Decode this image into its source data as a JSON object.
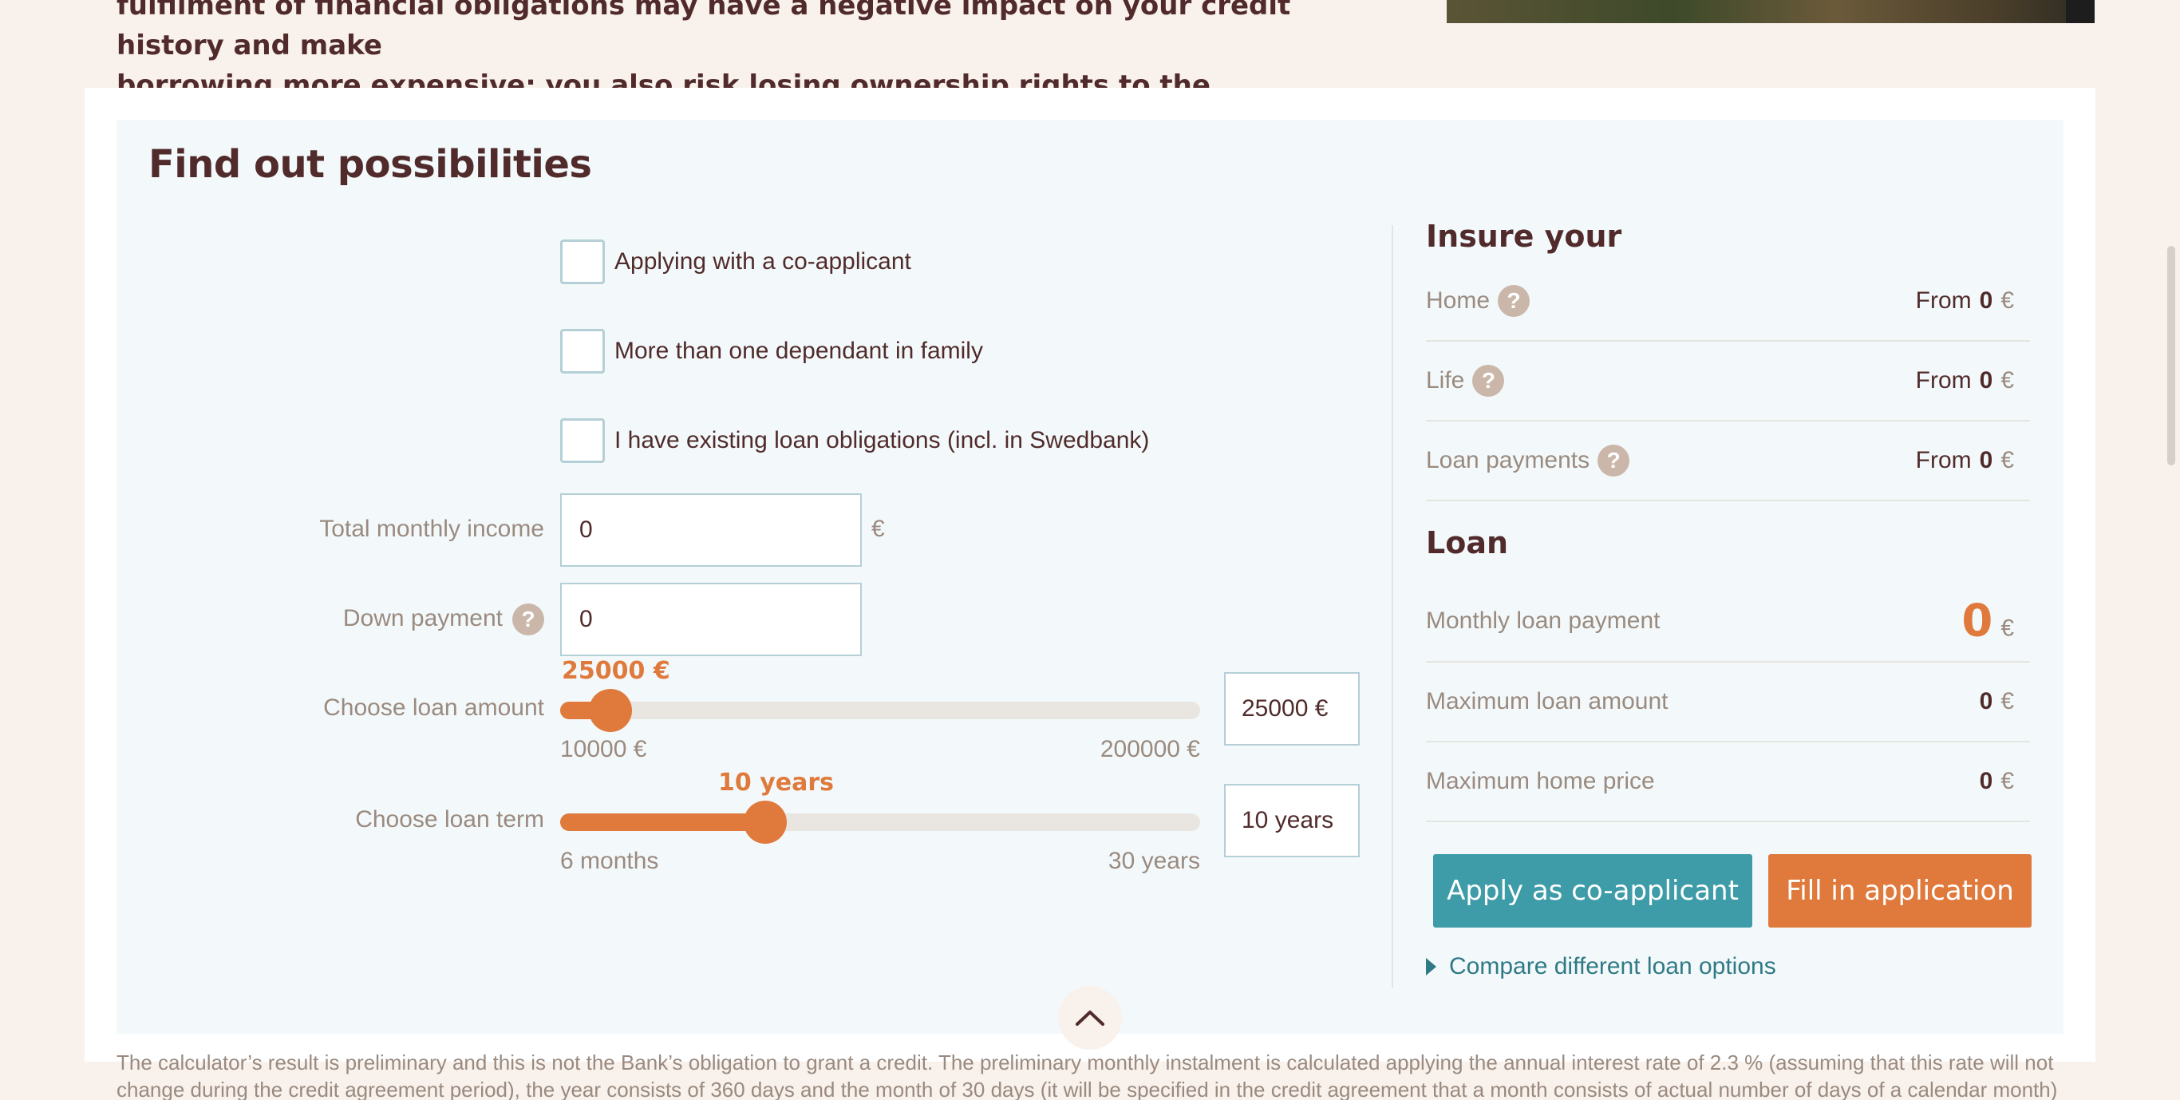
{
  "intro": {
    "line1": "fulfilment of financial obligations may have a negative impact on your credit history and make",
    "line2": "borrowing more expensive; you also risk losing ownership rights to the mortgaged real estate."
  },
  "calculator": {
    "title": "Find out possibilities",
    "checkboxes": {
      "co_applicant": "Applying with a co-applicant",
      "dependants": "More than one dependant in family",
      "existing_loans": "I have existing loan obligations (incl. in Swedbank)"
    },
    "income": {
      "label": "Total monthly income",
      "value": "0",
      "unit": "€"
    },
    "down_payment": {
      "label": "Down payment",
      "value": "0",
      "help": "?"
    },
    "loan_amount": {
      "label": "Choose loan amount",
      "value_label": "25000 €",
      "min_label": "10000 €",
      "max_label": "200000 €",
      "box_value": "25000 €",
      "min": 10000,
      "max": 200000,
      "value": 25000
    },
    "loan_term": {
      "label": "Choose loan term",
      "value_label": "10 years",
      "min_label": "6 months",
      "max_label": "30 years",
      "box_value": "10 years",
      "fraction": 0.32
    }
  },
  "insure": {
    "heading": "Insure your",
    "rows": [
      {
        "label": "Home",
        "help": "?",
        "prefix": "From",
        "value": "0",
        "currency": "€"
      },
      {
        "label": "Life",
        "help": "?",
        "prefix": "From",
        "value": "0",
        "currency": "€"
      },
      {
        "label": "Loan payments",
        "help": "?",
        "prefix": "From",
        "value": "0",
        "currency": "€"
      }
    ]
  },
  "loan": {
    "heading": "Loan",
    "monthly": {
      "label": "Monthly loan payment",
      "value": "0",
      "currency": "€"
    },
    "max_amount": {
      "label": "Maximum loan amount",
      "value": "0",
      "currency": "€"
    },
    "max_price": {
      "label": "Maximum home price",
      "value": "0",
      "currency": "€"
    }
  },
  "buttons": {
    "co_applicant": "Apply as co-applicant",
    "fill": "Fill in application",
    "compare": "Compare different loan options"
  },
  "disclaimer": "The calculator’s result is preliminary and this is not the Bank’s obligation to grant a credit. The preliminary monthly instalment is calculated applying the annual interest rate of 2.3 % (assuming that this rate will not change during the credit agreement period), the year consists of 360 days and the month of 30 days (it will be specified in the credit agreement that a month consists of actual number of days of a calendar month)",
  "colors": {
    "accent": "#e07a3c",
    "teal": "#3e9ba8",
    "text": "#512b2b",
    "muted": "#9a8a7f"
  }
}
